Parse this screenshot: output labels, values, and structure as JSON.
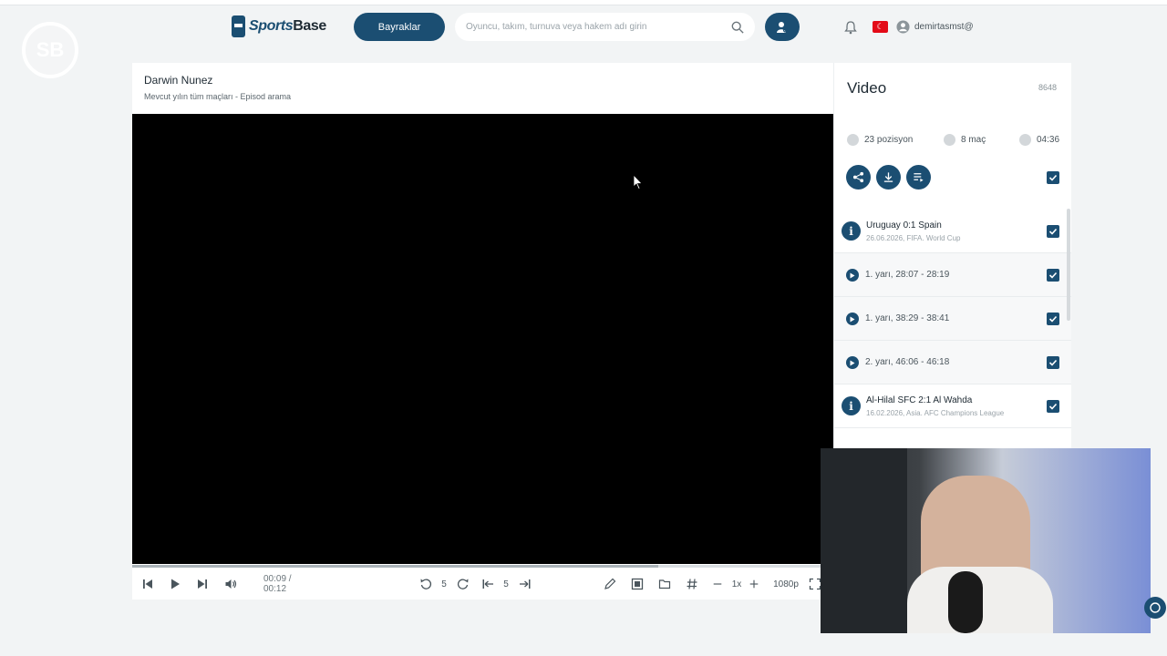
{
  "header": {
    "corner_logo": "SB",
    "brand": {
      "part1": "Sports",
      "part2": "Base"
    },
    "flags_button": "Bayraklar",
    "search_placeholder": "Oyuncu, takım, turnuva veya hakem adı girin",
    "username": "demirtasmst@"
  },
  "player": {
    "title": "Darwin Nunez",
    "subtitle": "Mevcut yılın tüm maçları - Episod arama",
    "progress_fraction": 0.75,
    "time": "00:09 / 00:12",
    "rewind_seconds": "5",
    "skip_seconds": "5",
    "speed": "1x",
    "quality": "1080p"
  },
  "sidebar": {
    "title": "Video",
    "count": "8648",
    "stats": {
      "positions": "23 pozisyon",
      "matches": "8 maç",
      "duration": "04:36"
    },
    "items": [
      {
        "type": "match",
        "title": "Uruguay 0:1 Spain",
        "meta": "26.06.2026, FIFA. World Cup"
      },
      {
        "type": "clip",
        "label": "1. yarı, 28:07 - 28:19"
      },
      {
        "type": "clip",
        "label": "1. yarı, 38:29 - 38:41"
      },
      {
        "type": "clip",
        "label": "2. yarı, 46:06 - 46:18"
      },
      {
        "type": "match",
        "title": "Al-Hilal SFC 2:1 Al Wahda",
        "meta": "16.02.2026, Asia. AFC Champions League"
      }
    ]
  },
  "colors": {
    "primary": "#1b4e72",
    "video_bg": "#000000",
    "page_bg": "#f2f4f5"
  }
}
